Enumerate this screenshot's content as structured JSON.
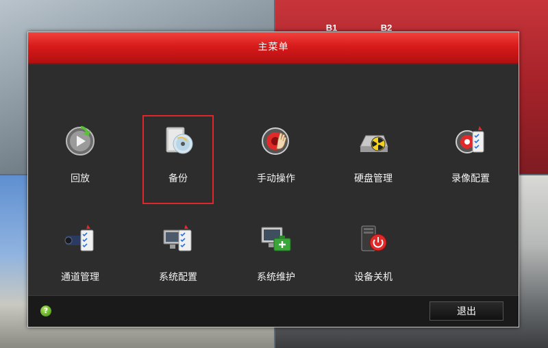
{
  "background": {
    "sign_b1": "B1",
    "sign_b2": "B2"
  },
  "dialog": {
    "title": "主菜单",
    "items": [
      {
        "label": "回放",
        "icon": "playback-icon"
      },
      {
        "label": "备份",
        "icon": "backup-disc-icon",
        "selected": true
      },
      {
        "label": "手动操作",
        "icon": "manual-operation-icon"
      },
      {
        "label": "硬盘管理",
        "icon": "hdd-management-icon"
      },
      {
        "label": "录像配置",
        "icon": "record-config-icon"
      },
      {
        "label": "通道管理",
        "icon": "camera-channel-icon"
      },
      {
        "label": "系统配置",
        "icon": "system-config-icon"
      },
      {
        "label": "系统维护",
        "icon": "system-maintenance-icon"
      },
      {
        "label": "设备关机",
        "icon": "device-shutdown-icon"
      }
    ],
    "footer": {
      "help_glyph": "?",
      "exit_label": "退出"
    }
  },
  "colors": {
    "title_red": "#d81b1b",
    "selection_red": "#e0262a",
    "panel_bg": "#2d2d2d"
  }
}
